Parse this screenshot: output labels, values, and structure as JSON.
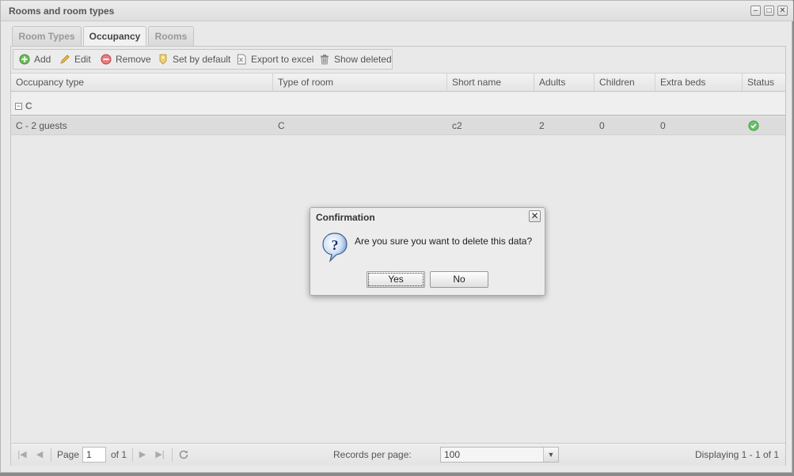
{
  "window": {
    "title": "Rooms and room types"
  },
  "tabs": [
    {
      "label": "Room Types",
      "active": false
    },
    {
      "label": "Occupancy",
      "active": true
    },
    {
      "label": "Rooms",
      "active": false
    }
  ],
  "toolbar": {
    "add": "Add",
    "edit": "Edit",
    "remove": "Remove",
    "set_default": "Set by default",
    "export": "Export to excel",
    "show_deleted": "Show deleted"
  },
  "grid": {
    "columns": [
      "Occupancy type",
      "Type of room",
      "Short name",
      "Adults",
      "Children",
      "Extra beds",
      "Status"
    ],
    "group": {
      "label": "C"
    },
    "rows": [
      {
        "occupancy_type": "C - 2 guests",
        "type_of_room": "C",
        "short_name": "c2",
        "adults": "2",
        "children": "0",
        "extra_beds": "0",
        "status": "check-icon"
      }
    ]
  },
  "pager": {
    "page_label": "Page",
    "page_value": "1",
    "of_label": "of 1",
    "records_label": "Records per page:",
    "records_value": "100",
    "displaying": "Displaying 1 - 1 of 1"
  },
  "dialog": {
    "title": "Confirmation",
    "message": "Are you sure you want to delete this data?",
    "yes": "Yes",
    "no": "No"
  },
  "colors": {
    "status_ok": "#5cb85c",
    "add_green": "#4caf50",
    "remove_red": "#e05555"
  }
}
